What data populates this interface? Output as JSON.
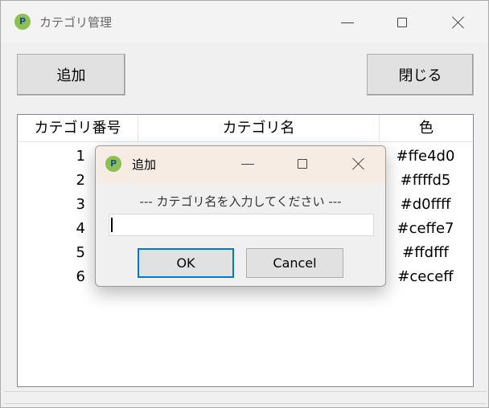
{
  "window": {
    "title": "カテゴリ管理",
    "icon": "app-p-icon"
  },
  "toolbar": {
    "add_label": "追加",
    "close_label": "閉じる"
  },
  "table": {
    "headers": [
      "カテゴリ番号",
      "カテゴリ名",
      "色"
    ],
    "rows": [
      {
        "num": "1",
        "name": "",
        "color": "#ffe4d0"
      },
      {
        "num": "2",
        "name": "",
        "color": "#ffffd5"
      },
      {
        "num": "3",
        "name": "",
        "color": "#d0ffff"
      },
      {
        "num": "4",
        "name": "",
        "color": "#ceffe7"
      },
      {
        "num": "5",
        "name": "",
        "color": "#ffdfff"
      },
      {
        "num": "6",
        "name": "",
        "color": "#ceceff"
      }
    ]
  },
  "dialog": {
    "title": "追加",
    "prompt": "--- カテゴリ名を入力してください ---",
    "input_value": "",
    "ok_label": "OK",
    "cancel_label": "Cancel"
  },
  "colors": {
    "dialog_titlebar": "#f7ece4",
    "window_bg": "#f0f0f0",
    "icon_green": "#8cc152"
  }
}
